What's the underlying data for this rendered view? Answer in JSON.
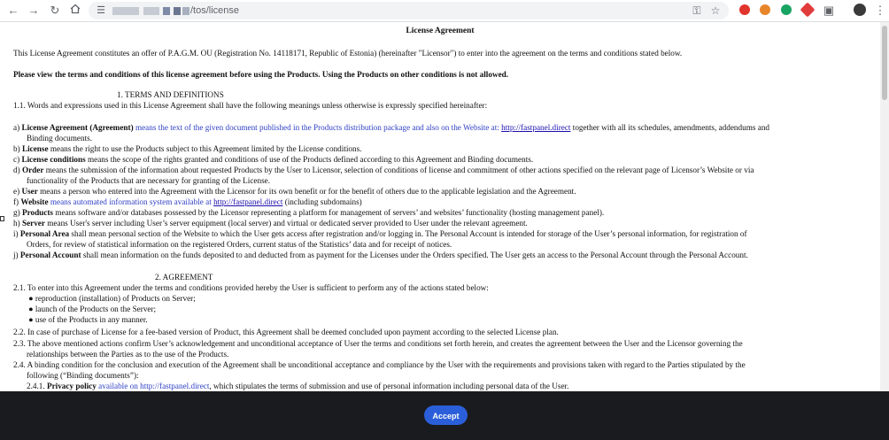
{
  "browser": {
    "url_path": "/tos/license",
    "nav_icons": [
      "back-icon",
      "forward-icon",
      "reload-icon",
      "home-icon"
    ]
  },
  "document": {
    "title": "License Agreement",
    "intro": "This License Agreement constitutes an offer of P.A.G.M. OU (Registration No. 14118171, Republic of Estonia) (hereinafter \"Licensor\") to enter into the agreement on the terms and conditions stated below.",
    "warning": "Please view the terms and conditions of this license agreement before using the Products. Using the Products on other conditions is not allowed.",
    "section1_heading": "1. TERMS AND DEFINITIONS",
    "s1_1": "1.1. Words and expressions used in this License Agreement shall have the following meanings unless otherwise is expressly specified hereinafter:",
    "a_prefix": "a) ",
    "a_term": "License Agreement (Agreement)",
    "a_blue": " means the text of the given document published in the Products distribution package and also on the Website at: ",
    "a_link": "http://fastpanel.direct",
    "a_rest": " together with all its schedules, amendments, addendums and",
    "a_cont": "Binding documents.",
    "b_prefix": "b) ",
    "b_term": "License",
    "b_rest": " means the right to use the Products subject to this Agreement limited by the License conditions.",
    "c_prefix": "c) ",
    "c_term": "License conditions",
    "c_rest": " means the scope of the rights granted and conditions of use of the Products defined according to this Agreement and Binding documents.",
    "d_prefix": "d) ",
    "d_term": "Order",
    "d_rest": " means the submission of the information about requested Products by the User to Licensor, selection of conditions of license and commitment of other actions specified on the relevant page of Licensor’s Website or via",
    "d_cont": "functionality of the Products that are necessary for granting of the License.",
    "e_prefix": "e) ",
    "e_term": "User",
    "e_rest": " means a person who entered into the Agreement with the Licensor for its own benefit or for the benefit of others due to the applicable legislation and the Agreement.",
    "f_prefix": "f) ",
    "f_term": "Website",
    "f_blue": " means automated information system available at ",
    "f_link": "http://fastpanel.direct",
    "f_rest": " (including subdomains)",
    "g_prefix": "g) ",
    "g_term": "Products",
    "g_rest": " means software and/or databases possessed by the Licensor representing a platform for management of servers’ and websites’ functionality (hosting management panel).",
    "h_prefix": "h) ",
    "h_term": "Server",
    "h_rest": " means User's server including User’s server equipment (local server) and virtual or dedicated server provided to User under the relevant agreement.",
    "i_prefix": "i) ",
    "i_term": "Personal Area",
    "i_rest": " shall mean personal section of the Website to which the User gets access after registration and/or logging in. The Personal Account is intended for storage of the User’s personal information, for registration of",
    "i_cont": "Orders, for review of statistical information on the registered Orders, current status of the Statistics’ data and for receipt of notices.",
    "j_prefix": "j) ",
    "j_term": "Personal Account",
    "j_rest": " shall mean information on the funds deposited to and deducted from as payment for the Licenses under the Orders specified. The User gets an access to the Personal Account through the Personal Account.",
    "section2_heading": "2. AGREEMENT",
    "s2_1": "2.1. To enter into this Agreement under the terms and conditions provided hereby the User is sufficient to perform any of the actions stated below:",
    "bullets": [
      "reproduction (installation) of Products on Server;",
      "launch of the Products on the Server;",
      "use of the Products in any manner."
    ],
    "s2_2": "2.2. In case of purchase of License for a fee-based version of Product, this Agreement shall be deemed concluded upon payment according to the selected License plan.",
    "s2_3": "2.3. The above mentioned actions confirm User’s acknowledgement and unconditional acceptance of User the terms and conditions set forth herein, and creates the agreement between the User and the Licensor governing the",
    "s2_3_cont": "relationships between the Parties as to the use of the Products.",
    "s2_4": "2.4. A binding condition for the conclusion and execution of the Agreement shall be unconditional acceptance and compliance by the User with the requirements and provisions taken with regard to the Parties stipulated by the",
    "s2_4_cont": "following (“Binding documents”):",
    "s2_4_1_prefix": "2.4.1. ",
    "s2_4_1_term": "Privacy policy",
    "s2_4_1_blue": " available on http://fastpanel.direct",
    "s2_4_1_rest": ", which stipulates the terms of submission and use of personal information including personal data of the User."
  },
  "footer": {
    "accept_label": "Accept"
  },
  "colors": {
    "footer_bg": "#1a1b1e",
    "accept_bg": "#2b5fd9",
    "definition_blue": "#2d3fc4"
  }
}
